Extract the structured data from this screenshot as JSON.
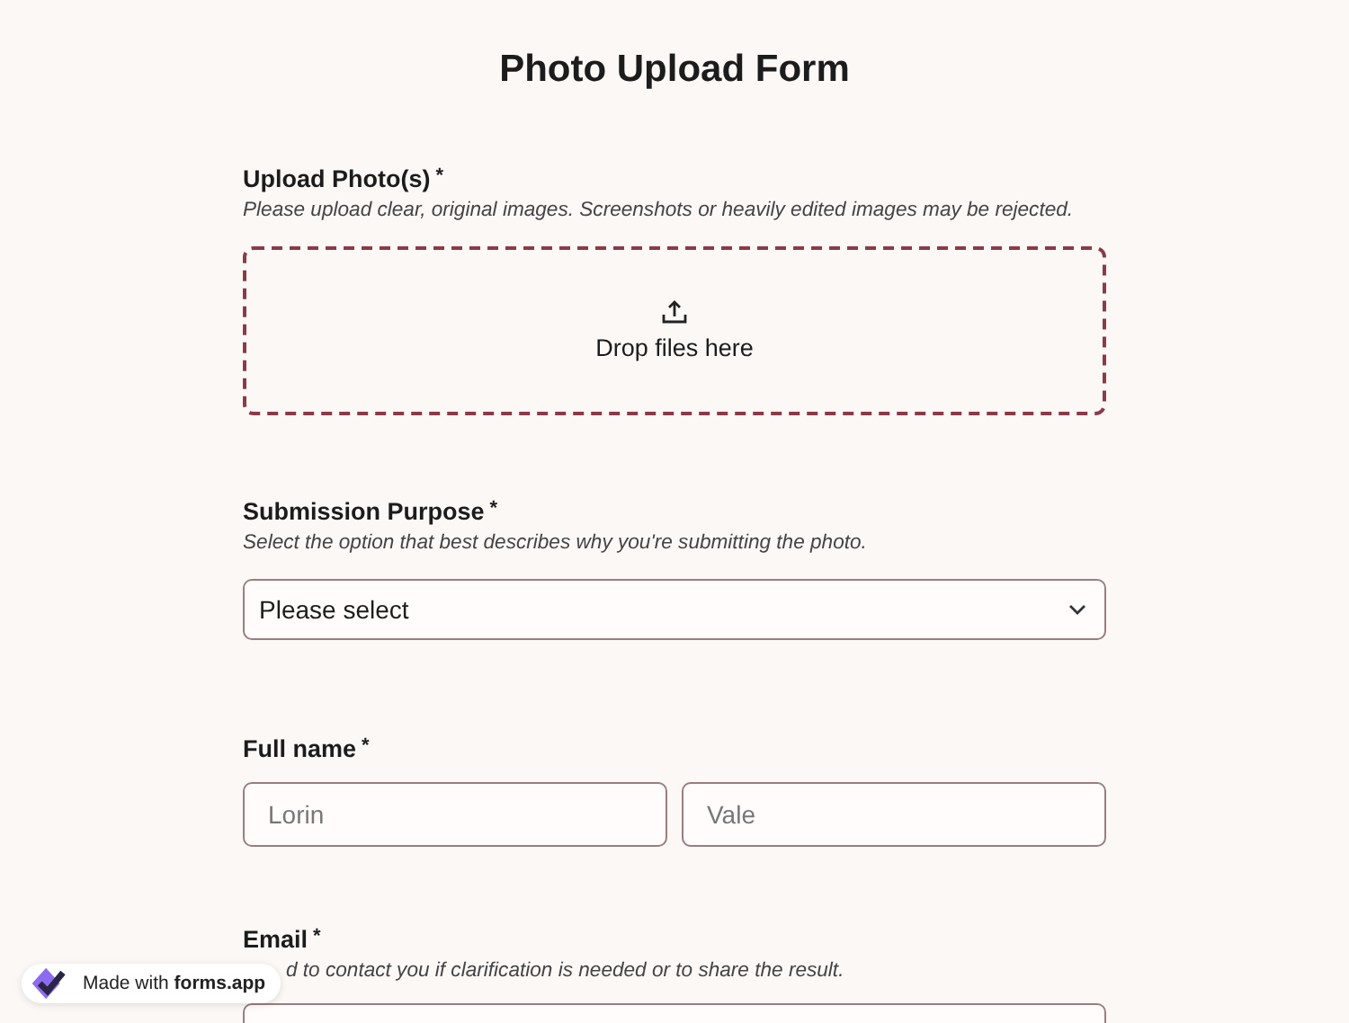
{
  "title": "Photo Upload Form",
  "upload": {
    "label": "Upload Photo(s)",
    "required_mark": "*",
    "hint": "Please upload clear, original images. Screenshots or heavily edited images may be rejected.",
    "drop_text": "Drop files here"
  },
  "purpose": {
    "label": "Submission Purpose",
    "required_mark": "*",
    "hint": "Select the option that best describes why you're submitting the photo.",
    "placeholder": "Please select"
  },
  "full_name": {
    "label": "Full name",
    "required_mark": "*",
    "fields": [
      {
        "placeholder": "Lorin"
      },
      {
        "placeholder": "Vale"
      }
    ]
  },
  "email": {
    "label": "Email",
    "required_mark": "*",
    "hint": "d to contact you if clarification is needed or to share the result."
  },
  "badge": {
    "prefix": "Made with",
    "brand": "forms.app"
  }
}
